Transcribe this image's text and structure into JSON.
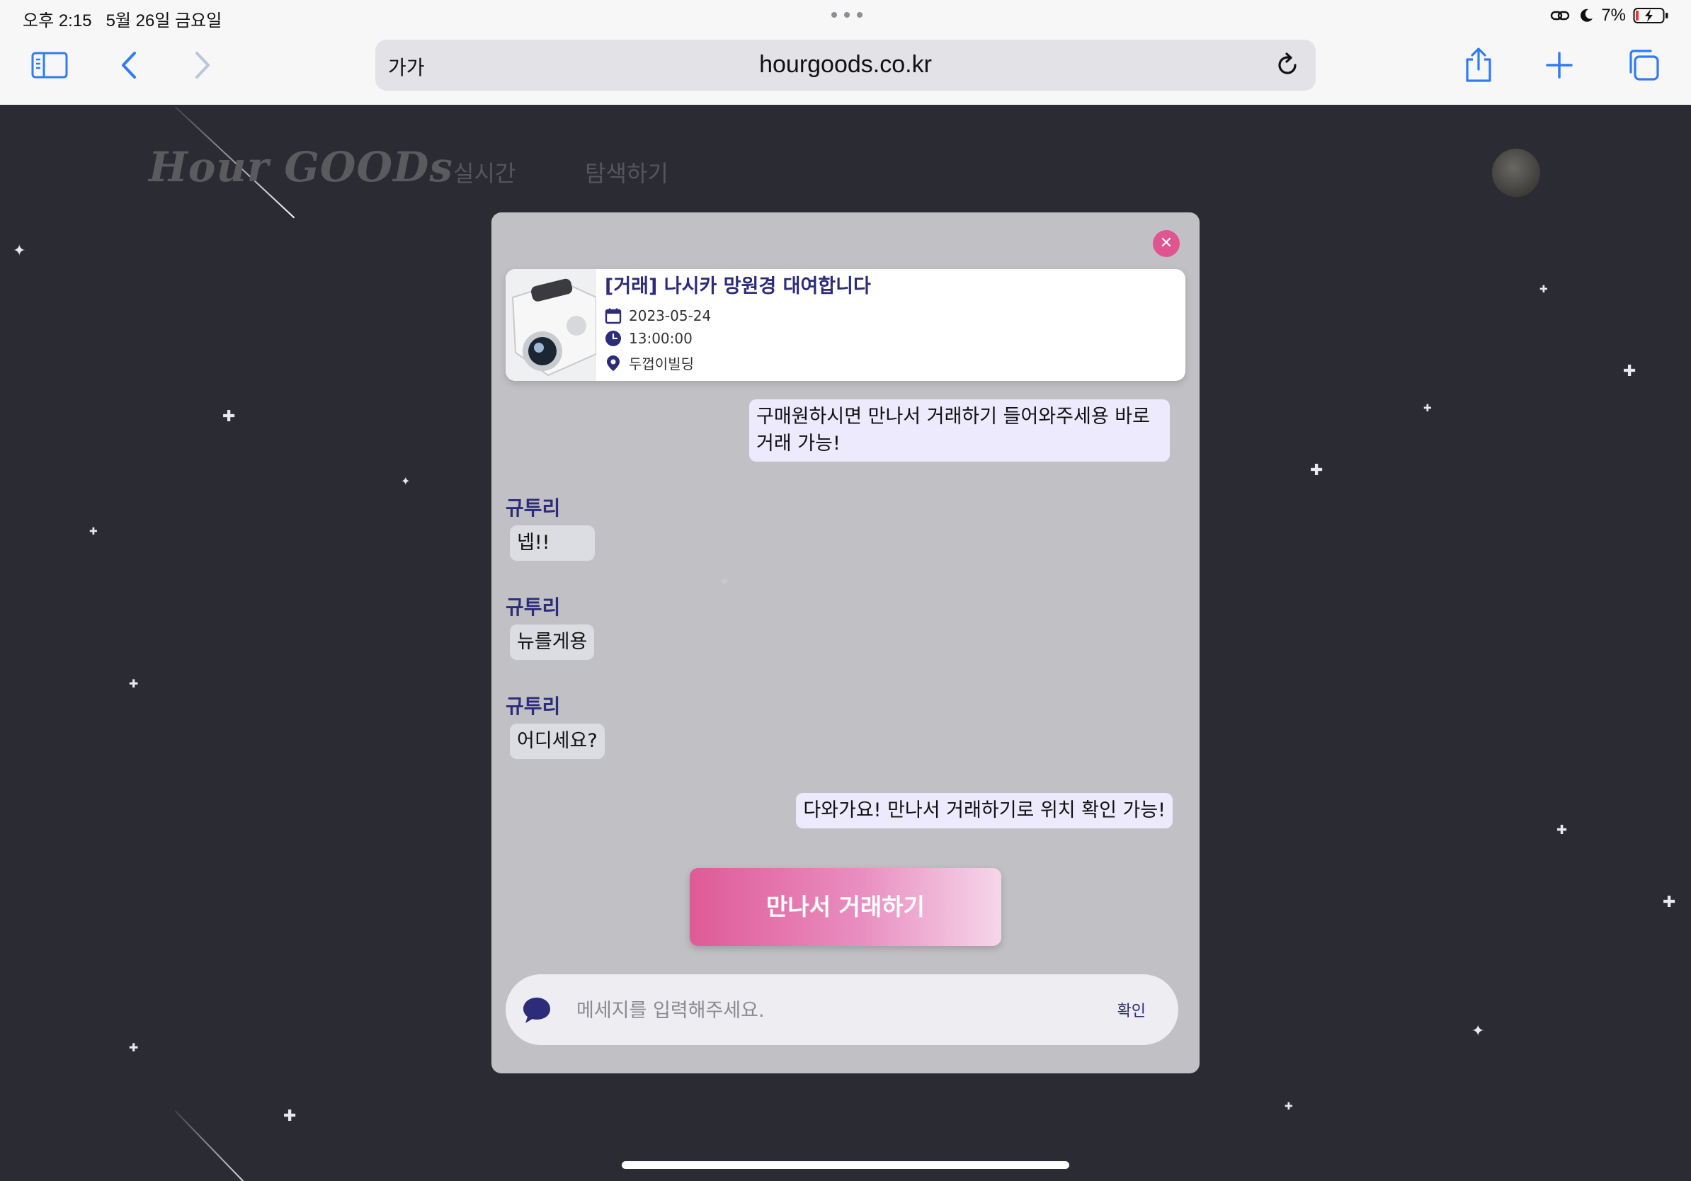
{
  "status_bar": {
    "time": "오후 2:15",
    "date": "5월 26일 금요일",
    "battery": "7%"
  },
  "browser": {
    "text_size_label": "가가",
    "url": "hourgoods.co.kr"
  },
  "site": {
    "logo": "Hour GOODs",
    "nav": [
      "실시간",
      "탐색하기"
    ]
  },
  "product": {
    "title": "[거래] 나시카 망원경 대여합니다",
    "date": "2023-05-24",
    "time": "13:00:00",
    "location": "두껍이빌딩"
  },
  "messages": [
    {
      "from": "me",
      "text_lines": [
        "구매원하시면 만나서 거래하기 들어와주세용 바로",
        "거래 가능!"
      ]
    },
    {
      "from": "other",
      "sender": "규투리",
      "text": "넵!!"
    },
    {
      "from": "other",
      "sender": "규투리",
      "text": "뉴를게용"
    },
    {
      "from": "other",
      "sender": "규투리",
      "text": "어디세요?"
    },
    {
      "from": "me",
      "text": "다와가요! 만나서 거래하기로 위치 확인 가능!"
    }
  ],
  "meet_button_label": "만나서 거래하기",
  "input": {
    "placeholder": "메세지를 입력해주세요.",
    "value": "",
    "submit_label": "확인"
  },
  "colors": {
    "accent_pink": "#e0558f",
    "navy_text": "#2c2c7a",
    "my_bubble": "#eceafc",
    "other_bubble": "#dcdde2"
  }
}
